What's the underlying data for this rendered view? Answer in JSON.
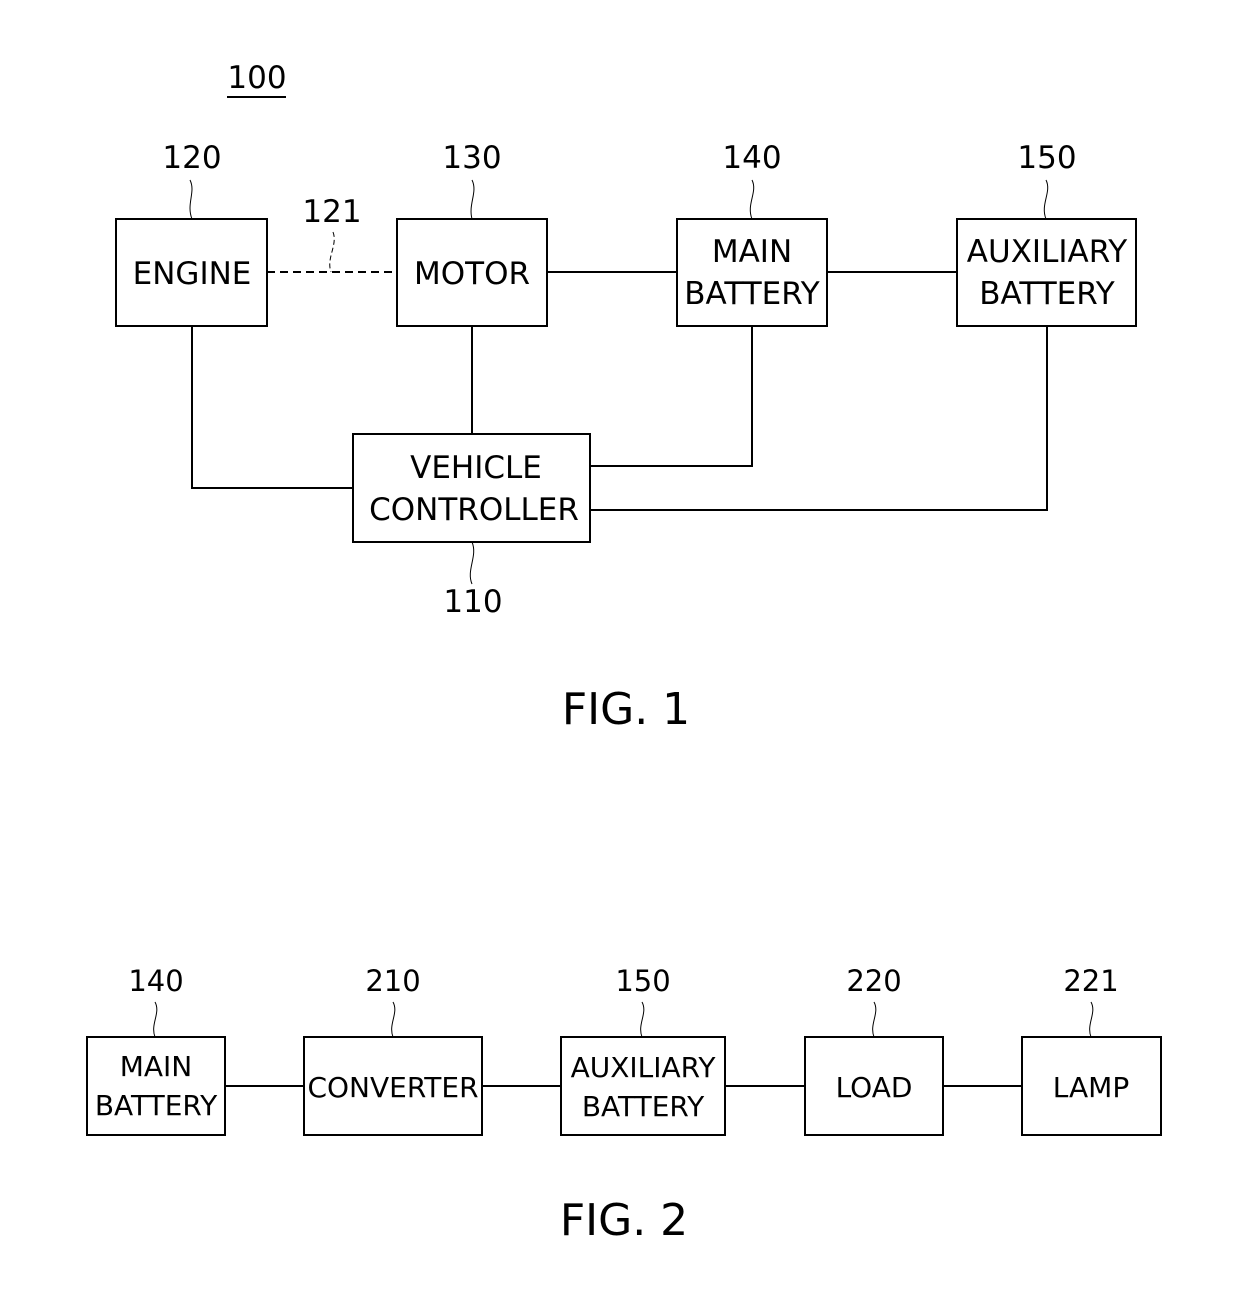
{
  "fig1": {
    "system_ref": "100",
    "caption": "FIG. 1",
    "engine": {
      "ref": "120",
      "lines": [
        "ENGINE"
      ]
    },
    "motor": {
      "ref": "130",
      "lines": [
        "MOTOR"
      ]
    },
    "main_battery": {
      "ref": "140",
      "lines": [
        "MAIN",
        "BATTERY"
      ]
    },
    "auxiliary_battery": {
      "ref": "150",
      "lines": [
        "AUXILIARY",
        "BATTERY"
      ]
    },
    "vehicle_controller": {
      "ref": "110",
      "lines": [
        "VEHICLE",
        "CONTROLLER"
      ]
    },
    "clutch_link": {
      "ref": "121",
      "style": "dashed"
    },
    "connections": [
      [
        "engine",
        "motor",
        "dashed"
      ],
      [
        "motor",
        "main_battery",
        "solid"
      ],
      [
        "main_battery",
        "auxiliary_battery",
        "solid"
      ],
      [
        "engine",
        "vehicle_controller",
        "solid"
      ],
      [
        "motor",
        "vehicle_controller",
        "solid"
      ],
      [
        "main_battery",
        "vehicle_controller",
        "solid"
      ],
      [
        "auxiliary_battery",
        "vehicle_controller",
        "solid"
      ]
    ]
  },
  "fig2": {
    "caption": "FIG. 2",
    "main_battery": {
      "ref": "140",
      "lines": [
        "MAIN",
        "BATTERY"
      ]
    },
    "converter": {
      "ref": "210",
      "lines": [
        "CONVERTER"
      ]
    },
    "auxiliary_battery": {
      "ref": "150",
      "lines": [
        "AUXILIARY",
        "BATTERY"
      ]
    },
    "load": {
      "ref": "220",
      "lines": [
        "LOAD"
      ]
    },
    "lamp": {
      "ref": "221",
      "lines": [
        "LAMP"
      ]
    },
    "connections": [
      [
        "main_battery",
        "converter",
        "solid"
      ],
      [
        "converter",
        "auxiliary_battery",
        "solid"
      ],
      [
        "auxiliary_battery",
        "load",
        "solid"
      ],
      [
        "load",
        "lamp",
        "solid"
      ]
    ]
  }
}
